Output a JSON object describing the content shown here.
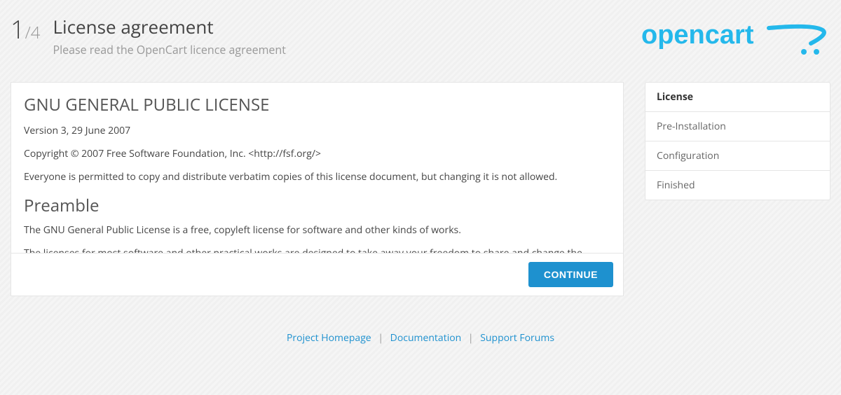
{
  "header": {
    "step_current": "1",
    "step_total": "/4",
    "title": "License agreement",
    "subtitle": "Please read the OpenCart licence agreement",
    "logo_text": "opencart"
  },
  "license": {
    "heading": "GNU GENERAL PUBLIC LICENSE",
    "version": "Version 3, 29 June 2007",
    "copyright": "Copyright © 2007 Free Software Foundation, Inc. <http://fsf.org/>",
    "permission": "Everyone is permitted to copy and distribute verbatim copies of this license document, but changing it is not allowed.",
    "preamble_heading": "Preamble",
    "preamble_p1": "The GNU General Public License is a free, copyleft license for software and other kinds of works.",
    "preamble_p2": "The licenses for most software and other practical works are designed to take away your freedom to share and change the works. By contrast, the GNU General Public License is intended to guarantee your freedom to share and change all versions of a program--to make sure it remains free software for all its users."
  },
  "buttons": {
    "continue": "CONTINUE"
  },
  "sidebar": {
    "steps": [
      {
        "label": "License",
        "active": true
      },
      {
        "label": "Pre-Installation",
        "active": false
      },
      {
        "label": "Configuration",
        "active": false
      },
      {
        "label": "Finished",
        "active": false
      }
    ]
  },
  "footer": {
    "links": [
      "Project Homepage",
      "Documentation",
      "Support Forums"
    ]
  }
}
